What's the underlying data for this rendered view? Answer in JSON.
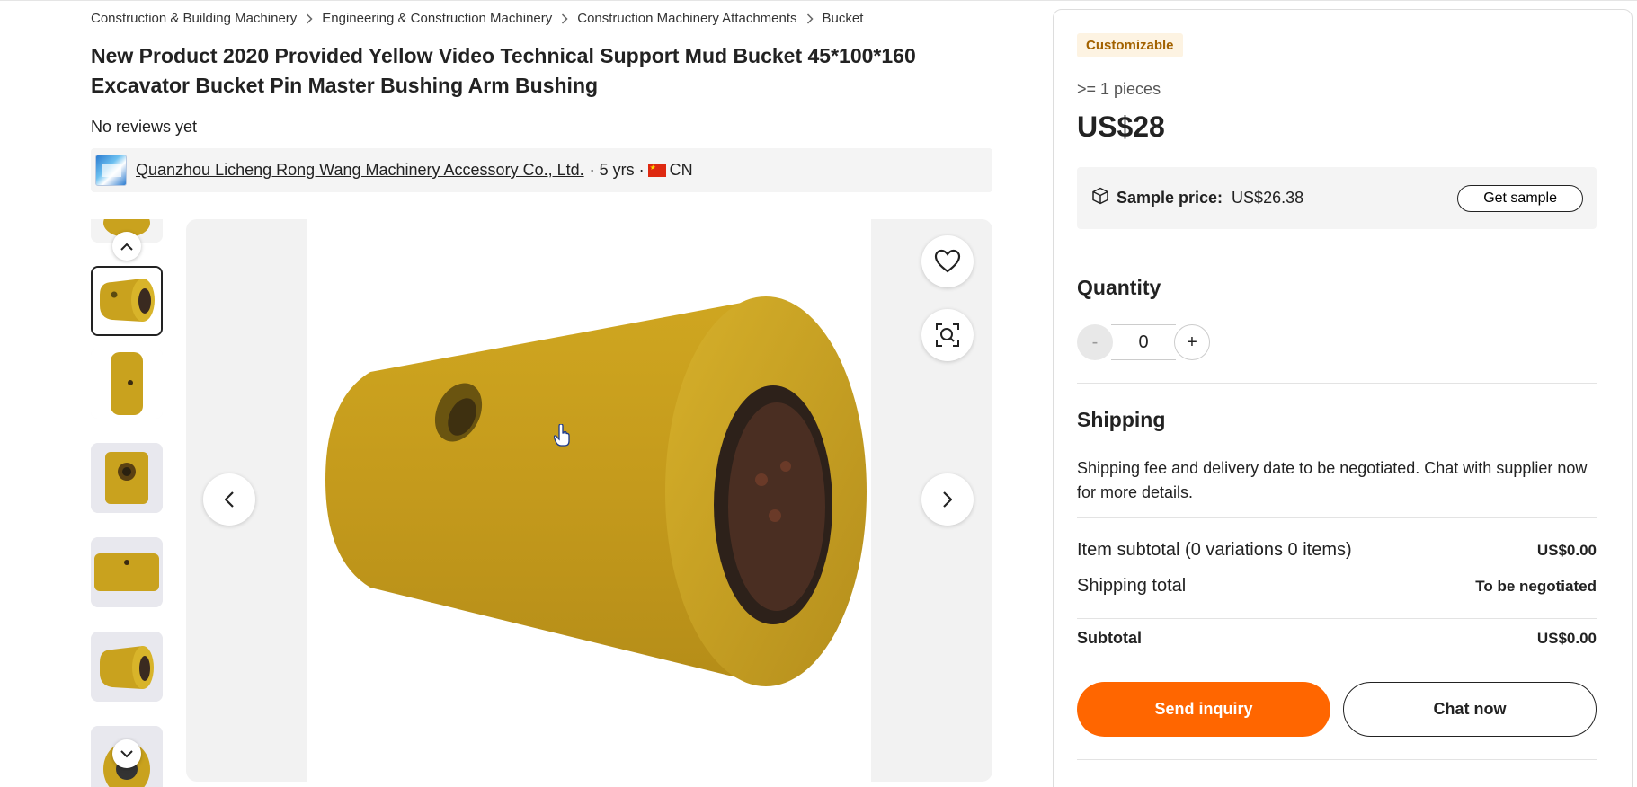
{
  "breadcrumb": [
    "Construction & Building Machinery",
    "Engineering & Construction Machinery",
    "Construction Machinery Attachments",
    "Bucket"
  ],
  "product": {
    "title": "New Product 2020 Provided Yellow Video Technical Support Mud Bucket 45*100*160 Excavator Bucket Pin Master Bushing Arm Bushing",
    "reviews": "No reviews yet"
  },
  "supplier": {
    "name": "Quanzhou Licheng Rong Wang Machinery Accessory Co., Ltd.",
    "years": "· 5 yrs ·",
    "country": "CN"
  },
  "gallery": {
    "selected_index": 1,
    "icons": {
      "favorite": "heart-icon",
      "image_search": "image-search-icon",
      "prev": "chevron-left-icon",
      "next": "chevron-right-icon",
      "thumbs_up": "chevron-up-icon",
      "thumbs_down": "chevron-down-icon"
    }
  },
  "panel": {
    "badge": "Customizable",
    "moq": ">= 1 pieces",
    "price": "US$28",
    "sample_label": "Sample price:",
    "sample_price": "US$26.38",
    "get_sample": "Get sample",
    "quantity_title": "Quantity",
    "quantity_value": "0",
    "minus": "-",
    "plus": "+",
    "shipping_title": "Shipping",
    "shipping_text": "Shipping fee and delivery date to be negotiated. Chat with supplier now for more details.",
    "item_subtotal_label": "Item subtotal (0 variations 0 items)",
    "item_subtotal_value": "US$0.00",
    "shipping_total_label": "Shipping total",
    "shipping_total_value": "To be negotiated",
    "subtotal_label": "Subtotal",
    "subtotal_value": "US$0.00",
    "send_inquiry": "Send inquiry",
    "chat_now": "Chat now"
  },
  "colors": {
    "accent": "#ff6600",
    "badge_text": "#a36200",
    "badge_bg": "#fdf3e2",
    "product_yellow": "#c9a21e"
  }
}
